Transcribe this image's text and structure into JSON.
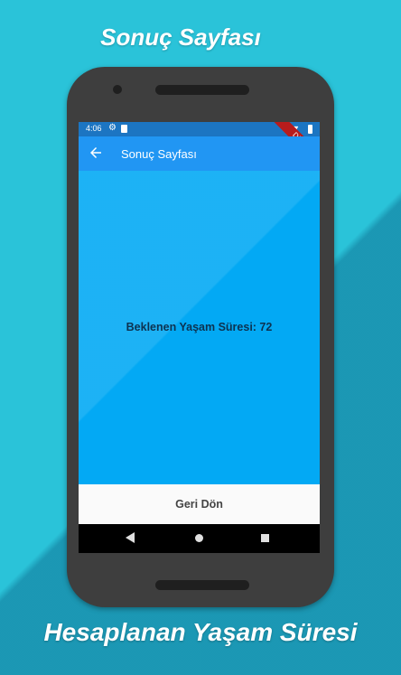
{
  "promo": {
    "title": "Sonuç Sayfası",
    "caption": "Hesaplanan Yaşam Süresi"
  },
  "status_bar": {
    "time": "4:06",
    "debug_label": "DEBUG"
  },
  "app_bar": {
    "title": "Sonuç Sayfası",
    "back_icon": "arrow-left-icon"
  },
  "content": {
    "result_text": "Beklenen Yaşam Süresi: 72"
  },
  "bottom_button": {
    "label": "Geri Dön"
  },
  "colors": {
    "background": "#2ac3d9",
    "phone_body": "#3e3e3e",
    "status_bar": "#1c75c2",
    "app_bar": "#2196f3",
    "content_bg": "#03a9f4",
    "result_text": "#0d3250",
    "button_bg": "#fafafa"
  }
}
